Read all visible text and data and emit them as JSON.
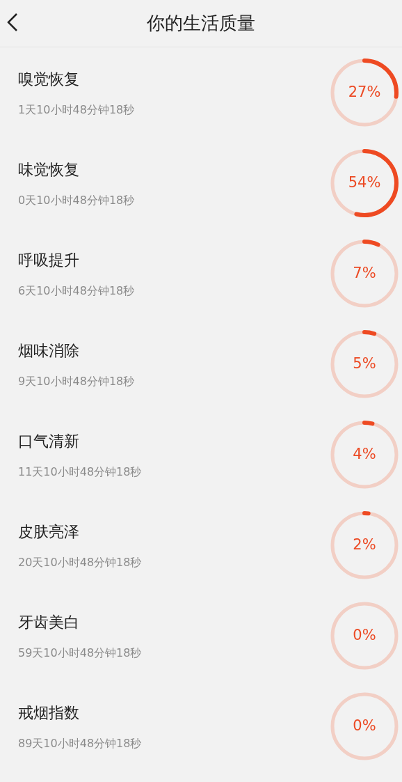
{
  "header": {
    "title": "你的生活质量"
  },
  "items": [
    {
      "title": "嗅觉恢复",
      "time": "1天10小时48分钟18秒",
      "percent": "27%"
    },
    {
      "title": "味觉恢复",
      "time": "0天10小时48分钟18秒",
      "percent": "54%"
    },
    {
      "title": "呼吸提升",
      "time": "6天10小时48分钟18秒",
      "percent": "7%"
    },
    {
      "title": "烟味消除",
      "time": "9天10小时48分钟18秒",
      "percent": "5%"
    },
    {
      "title": "口气清新",
      "time": "11天10小时48分钟18秒",
      "percent": "4%"
    },
    {
      "title": "皮肤亮泽",
      "time": "20天10小时48分钟18秒",
      "percent": "2%"
    },
    {
      "title": "牙齿美白",
      "time": "59天10小时48分钟18秒",
      "percent": "0%"
    },
    {
      "title": "戒烟指数",
      "time": "89天10小时48分钟18秒",
      "percent": "0%"
    }
  ]
}
